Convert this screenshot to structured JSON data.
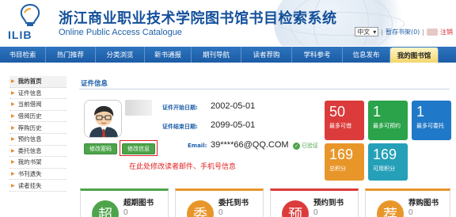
{
  "header": {
    "logo_text": "ILIB",
    "title": "浙江商业职业技术学院图书馆书目检索系统",
    "subtitle": "Online Public Access Catalogue",
    "language": "中文",
    "bookshelf": "暂存书架(0)",
    "exit": "注销",
    "brand_color": "#14509a"
  },
  "nav": {
    "items": [
      "书目检索",
      "热门推荐",
      "分类浏览",
      "新书通报",
      "期刊导航",
      "读者荐购",
      "学科参考",
      "信息发布",
      "我的图书馆"
    ],
    "active_index": 8
  },
  "sidebar": {
    "items": [
      "我的首页",
      "证件信息",
      "当前借阅",
      "借阅历史",
      "荐购历史",
      "预约信息",
      "委托信息",
      "我的书架",
      "书刊遗失",
      "读者挂失"
    ],
    "active_index": 0
  },
  "profile": {
    "section_title": "证件信息",
    "start_label": "证件开始日期:",
    "start_value": "2002-05-01",
    "end_label": "证件结束日期:",
    "end_value": "2099-05-01",
    "email_label": "Email:",
    "email_value": "39****66@QQ.COM",
    "verified_label": "已验证",
    "change_password": "修改密码",
    "edit_info": "修改信息",
    "note": "在此处修改读者邮件、手机号信息"
  },
  "stats": [
    {
      "value": "50",
      "label": "最多可借",
      "color": "#dc3b3b"
    },
    {
      "value": "1",
      "label": "最多可预约",
      "color": "#2aa34a"
    },
    {
      "value": "1",
      "label": "最多可委托",
      "color": "#1f78c8"
    },
    {
      "value": "169",
      "label": "总积分",
      "color": "#e8962a"
    },
    {
      "value": "169",
      "label": "可用积分",
      "color": "#25a0b8"
    }
  ],
  "cards": [
    {
      "icon_char": "超",
      "title": "超期图书",
      "count": "0",
      "color": "#4ea44b"
    },
    {
      "icon_char": "委",
      "title": "委托到书",
      "count": "0",
      "color": "#e8962a"
    },
    {
      "icon_char": "预",
      "title": "预约到书",
      "count": "0",
      "color": "#dc3b3b"
    },
    {
      "icon_char": "荐",
      "title": "荐购图书",
      "count": "0",
      "color": "#e8962a"
    }
  ]
}
